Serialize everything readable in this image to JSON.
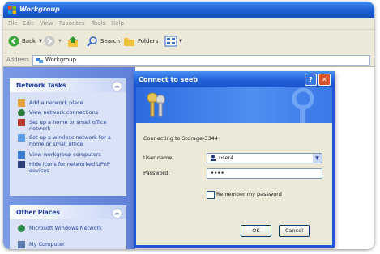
{
  "window": {
    "title": "Workgroup"
  },
  "menu": [
    "File",
    "Edit",
    "View",
    "Favorites",
    "Tools",
    "Help"
  ],
  "toolbar": {
    "back": "Back",
    "search": "Search",
    "folders": "Folders"
  },
  "address": {
    "label": "Address",
    "value": "Workgroup"
  },
  "network_tasks": {
    "title": "Network Tasks",
    "items": [
      "Add a network place",
      "View network connections",
      "Set up a home or small office network",
      "Set up a wireless network for a home or small office",
      "View workgroup computers",
      "Hide icons for networked UPnP devices"
    ]
  },
  "other_places": {
    "title": "Other Places",
    "items": [
      "Microsoft Windows Network",
      "My Computer"
    ]
  },
  "dialog": {
    "title": "Connect to seeb",
    "connecting": "Connecting to Storage-3344",
    "username_label": "User name:",
    "username_value": "user4",
    "password_label": "Password:",
    "password_value": "••••",
    "remember_label": "Remember my password",
    "ok": "OK",
    "cancel": "Cancel"
  },
  "colors": {
    "xp_blue": "#1f56d6",
    "panel_bg": "#d9e2f6",
    "task_text": "#20409a"
  }
}
